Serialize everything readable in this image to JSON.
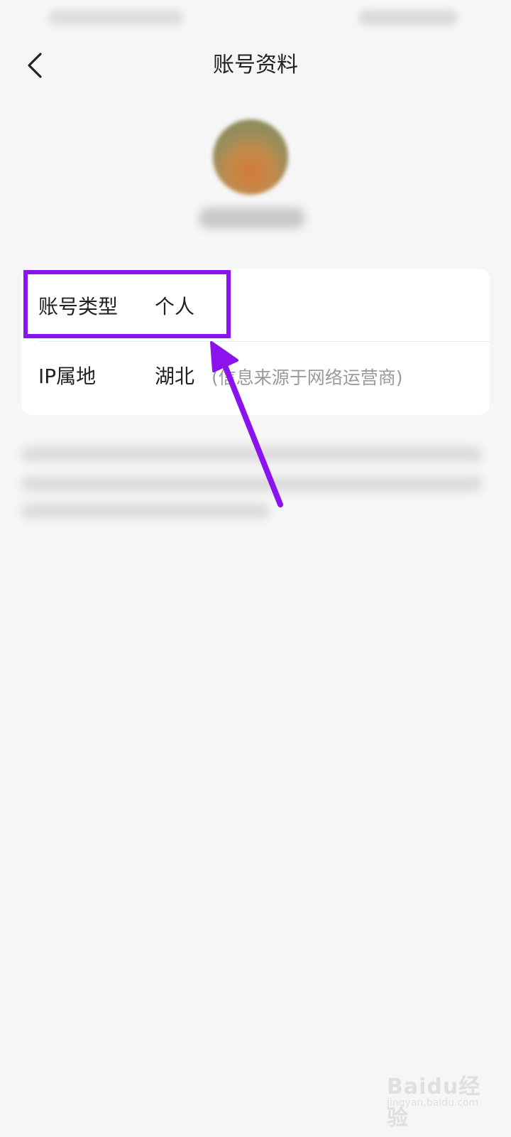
{
  "header": {
    "title": "账号资料"
  },
  "profile": {
    "avatar_colors": {
      "center": "#d27a3a",
      "edge": "#7f8a5b"
    }
  },
  "info_rows": [
    {
      "label": "账号类型",
      "value": "个人"
    },
    {
      "label": "IP属地",
      "value": "湖北",
      "note": "(信息来源于网络运营商)"
    }
  ],
  "annotation": {
    "color": "#8a13ee"
  },
  "watermark": {
    "main": "Baidu经验",
    "sub": "jingyan.baidu.com"
  },
  "icons": {
    "back": "chevron-left-icon"
  }
}
